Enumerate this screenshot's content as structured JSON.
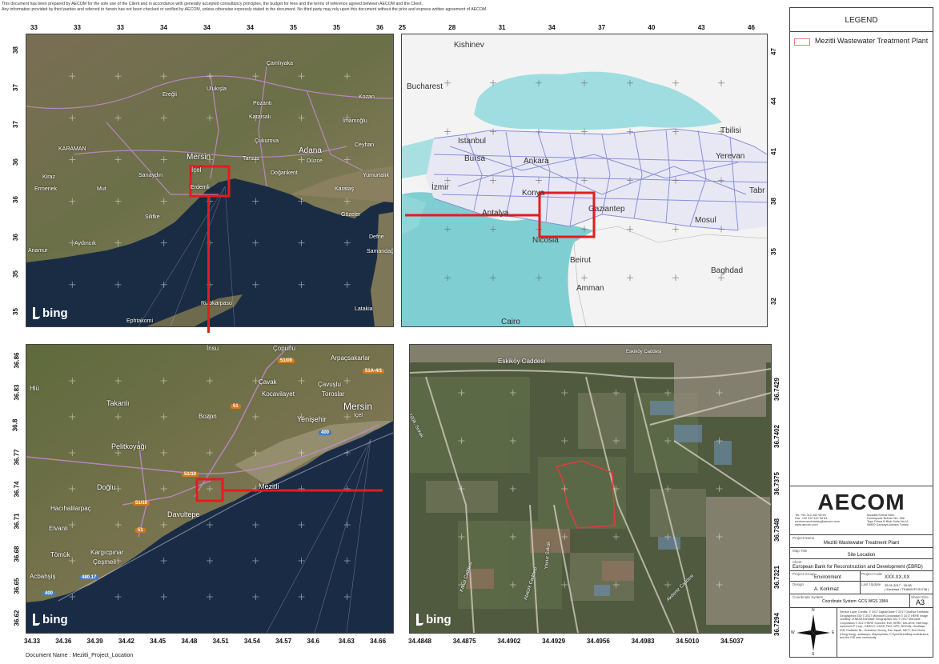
{
  "disclaimer": {
    "line1": "This document has been prepared by AECOM for the sole use of the Client and in accordance with generally accepted consultancy principles, the budget for fees and the terms of reference agreed between AECOM and the Client.",
    "line2": "Any information provided by third parties and referred to herein has not been checked or verified by AECOM, unless otherwise expressly stated in the document. No third party may rely upon this document without the prior and express written agreement of AECOM."
  },
  "map_tl": {
    "top_ticks": [
      "33",
      "33",
      "33",
      "34",
      "34",
      "34",
      "35",
      "35",
      "36"
    ],
    "left_ticks": [
      "38",
      "37",
      "37",
      "36",
      "36",
      "36",
      "35",
      "35"
    ],
    "labels": [
      "Mersin",
      "İçel",
      "Adana",
      "Tarsus",
      "KARAMAN",
      "Mut",
      "Silifke",
      "Aydıncık",
      "Anamur",
      "Erdemli",
      "Ceyhan",
      "Yumurtalık",
      "Karataş",
      "Gözeler",
      "Defne",
      "Samandağ",
      "Latakia",
      "Ephtakomi",
      "Rizokarpaso",
      "Ulukışla",
      "Pozantı",
      "Kozan",
      "İmamoğlu",
      "Çukurova",
      "Düzce",
      "Doğankent",
      "Çamlıyaka",
      "Ereğli",
      "Karaisalı",
      "Ermenek",
      "Kiraz",
      "Sarıaydın"
    ],
    "brand": "bing"
  },
  "map_tr": {
    "top_ticks": [
      "25",
      "28",
      "31",
      "34",
      "37",
      "40",
      "43",
      "46"
    ],
    "right_ticks": [
      "47",
      "44",
      "41",
      "38",
      "35",
      "32"
    ],
    "labels": [
      "Kishinev",
      "Bucharest",
      "Istanbul",
      "Bursa",
      "Ankara",
      "İzmir",
      "Konya",
      "Antalya",
      "Gaziantep",
      "Nicosia",
      "Beirut",
      "Amman",
      "Cairo",
      "Tbilisi",
      "Yerevan",
      "Tabr",
      "Mosul",
      "Baghdad"
    ]
  },
  "map_bl": {
    "bottom_ticks": [
      "34.33",
      "34.36",
      "34.39",
      "34.42",
      "34.45",
      "34.48",
      "34.51",
      "34.54",
      "34.57",
      "34.6",
      "34.63",
      "34.66"
    ],
    "left_ticks": [
      "36.86",
      "36.83",
      "36.8",
      "36.77",
      "36.74",
      "36.71",
      "36.68",
      "36.65",
      "36.62"
    ],
    "labels": [
      "Mersin",
      "İçel",
      "Mezitli",
      "Davultepe",
      "Yenişehir",
      "Toroslar",
      "Çavuşlu",
      "Kocavilayet",
      "Bozon",
      "Takanlı",
      "Pelitkoyağı",
      "Doğlu",
      "Hacıhalilarpaç",
      "Elvanlı",
      "Tömük",
      "Kargıcpınar",
      "Çeşmeli",
      "Acbahşiş",
      "Çavak",
      "Arpaçsakarlar",
      "Çopurlu",
      "İnsu",
      "Hlü"
    ],
    "road_badges": [
      "51/09",
      "51A-4/1",
      "51",
      "400",
      "51/10",
      "51/10",
      "51",
      "480.17",
      "400"
    ],
    "brand": "bing"
  },
  "map_br": {
    "bottom_ticks": [
      "34.4848",
      "34.4875",
      "34.4902",
      "34.4929",
      "34.4956",
      "34.4983",
      "34.5010",
      "34.5037"
    ],
    "right_ticks": [
      "36.7429",
      "36.7402",
      "36.7375",
      "36.7348",
      "36.7321",
      "36.7294"
    ],
    "labels": [
      "Eskiköy Caddesi",
      "Eskiköy Caddesi",
      "1008. Sokak",
      "Kanal Caddesi",
      "Atatürk Caddesi",
      "Akdeniz Caddesi",
      "Yavuz Sokak"
    ],
    "brand": "bing"
  },
  "legend": {
    "title": "LEGEND",
    "item_label": "Mezitli Wastewater Treatment Plant",
    "item_color": "#e08080"
  },
  "title_block": {
    "company": "AECOM",
    "contact_left": "Tel: +90 312 442 98 63\nFax: +90 312 442 98 63\nenvironment.turkey@aecom.com\nwww.aecom.com",
    "contact_right": "Mustafa Kemal Mah.\nDumlupınar Bulvarı No: 266\nTepe Prime B Blok Suite No:11\n06800 Çankaya Ankara Turkey",
    "project_name_label": "Project Name",
    "project_name": "Mezitli Wastewater Treatment Plant",
    "map_title_label": "Map Title",
    "map_title": "Site Location",
    "client_label": "Client",
    "client": "European Bank for Reconstruction and Development (EBRD)",
    "group_label": "Project Group",
    "group": "Environment",
    "code_label": "Project Code",
    "code": "XXX.XX.XX",
    "design_label": "Design",
    "design": "A. Korkmaz",
    "last_update_label": "Last Update",
    "last_update": "25.01.2017 - 15:38\n( Korkmaz / TKAN01FC31746 )",
    "coord_label": "Coordinate System",
    "coord": "Coordinate System: GCS WGS 1984",
    "sheet_label": "Sheet Size",
    "sheet": "A3",
    "credits": "Service Layer Credits: © 2017 DigitalGlobe © 2017 GeoEye Earthstar Geographics SIO © 2017 Microsoft Corporation © 2017 HERE Image courtesy of NASA Earthstar Geographics SIO © 2017 Microsoft Corporation © 2017 HERE Sources: Esri, HERE, DeLorme, Intermap, increment P Corp., GEBCO, USGS, FAO, NPS, NRCAN, GeoBase, IGN, Kadaster NL, Ordnance Survey, Esri Japan, METI, Esri China (Hong Kong), swisstopo, MapmyIndia, © OpenStreetMap contributors, and the GIS user community",
    "compass": [
      "N",
      "S",
      "E",
      "W"
    ]
  },
  "document_name": "Document Name : Mezitli_Project_Location"
}
